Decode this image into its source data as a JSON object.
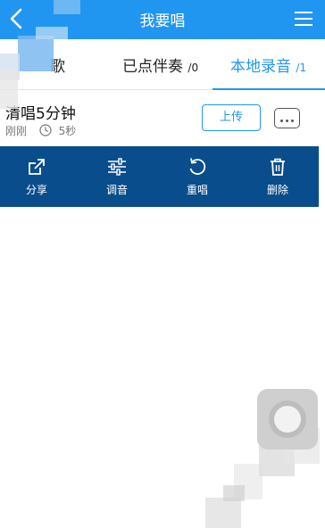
{
  "header": {
    "title": "我要唱",
    "back_icon": "chevron-left-icon",
    "menu_icon": "hamburger-menu-icon",
    "color": "#2196f0"
  },
  "tabs": [
    {
      "label": "歌",
      "count": ""
    },
    {
      "label": "已点伴奏",
      "count": "/0"
    },
    {
      "label": "本地录音",
      "count": "/1",
      "active": true
    }
  ],
  "recording": {
    "title": "清唱5分钟",
    "time": "刚刚",
    "duration": "5秒",
    "upload_label": "上传"
  },
  "actions": [
    {
      "label": "分享",
      "icon": "share-icon"
    },
    {
      "label": "调音",
      "icon": "equalizer-icon"
    },
    {
      "label": "重唱",
      "icon": "redo-icon"
    },
    {
      "label": "删除",
      "icon": "trash-icon"
    }
  ],
  "colors": {
    "accent": "#2196f0",
    "action_bar": "#0a4d8c"
  }
}
